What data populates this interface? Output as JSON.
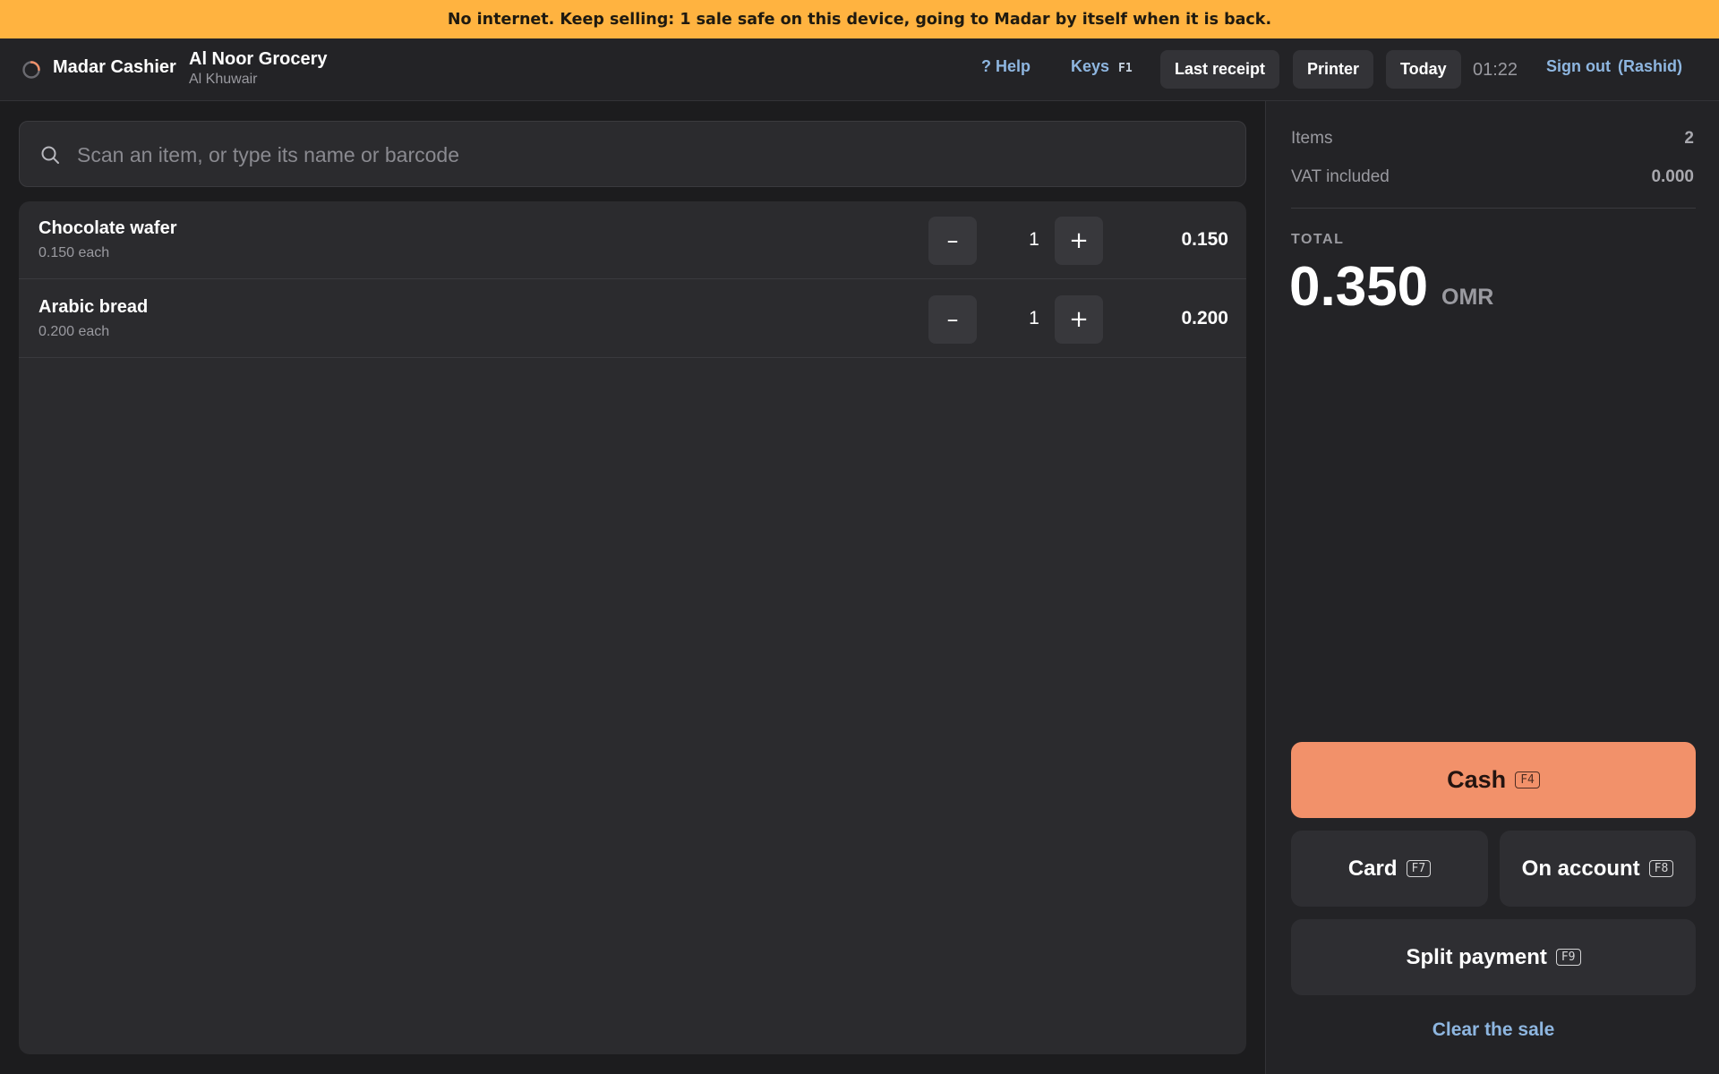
{
  "banner": {
    "message": "No internet. Keep selling: 1 sale safe on this device, going to Madar by itself when it is back."
  },
  "header": {
    "app_name": "Madar Cashier",
    "store_name": "Al Noor Grocery",
    "store_location": "Al Khuwair",
    "help_label": "? Help",
    "keys_label": "Keys",
    "keys_shortcut": "F1",
    "last_receipt_label": "Last receipt",
    "printer_label": "Printer",
    "today_label": "Today",
    "clock": "01:22",
    "sign_out_label": "Sign out",
    "user": "(Rashid)"
  },
  "search": {
    "placeholder": "Scan an item, or type its name or barcode",
    "value": ""
  },
  "cart": {
    "items": [
      {
        "name": "Chocolate wafer",
        "unit_price": "0.150 each",
        "qty": "1",
        "line_total": "0.150"
      },
      {
        "name": "Arabic bread",
        "unit_price": "0.200 each",
        "qty": "1",
        "line_total": "0.200"
      }
    ],
    "decrement_symbol": "–",
    "increment_symbol": "+"
  },
  "summary": {
    "items_label": "Items",
    "items_count": "2",
    "vat_label": "VAT included",
    "vat_value": "0.000",
    "total_label": "TOTAL",
    "total_amount": "0.350",
    "currency": "OMR"
  },
  "payments": {
    "cash_label": "Cash",
    "cash_key": "F4",
    "card_label": "Card",
    "card_key": "F7",
    "account_label": "On account",
    "account_key": "F8",
    "split_label": "Split payment",
    "split_key": "F9",
    "clear_label": "Clear the sale"
  },
  "colors": {
    "banner": "#ffb340",
    "cash_button": "#f2916a",
    "link": "#8eb6e0",
    "background": "#1c1c1e"
  },
  "icons": {
    "logo": "loading-ring-icon",
    "search": "search-icon"
  }
}
